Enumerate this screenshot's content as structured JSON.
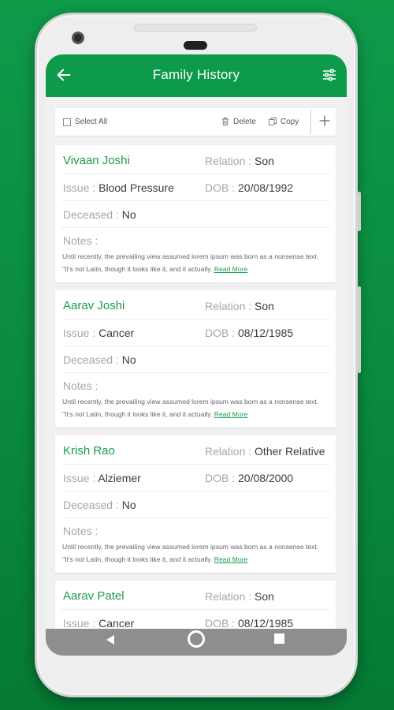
{
  "appbar": {
    "title": "Family History",
    "back_icon": "arrow-left-icon",
    "filter_icon": "sliders-icon"
  },
  "toolbar": {
    "select_all": "Select All",
    "delete": "Delete",
    "copy": "Copy",
    "add_icon": "plus-icon"
  },
  "labels": {
    "relation": "Relation : ",
    "issue": "Issue : ",
    "dob": "DOB : ",
    "deceased": "Deceased : ",
    "notes": "Notes :",
    "read_more": "Read More"
  },
  "records": [
    {
      "name": "Vivaan Joshi",
      "relation": "Son",
      "issue": "Blood Pressure",
      "dob": "20/08/1992",
      "deceased": "No",
      "notes": "Until recently, the prevailing view assumed lorem ipsum was born as a nonsense text. \"It's not Latin, though it looks like it, and it actually."
    },
    {
      "name": "Aarav Joshi",
      "relation": "Son",
      "issue": "Cancer",
      "dob": "08/12/1985",
      "deceased": "No",
      "notes": "Until recently, the prevailing view assumed lorem ipsum was born as a nonsense text. \"It's not Latin, though it looks like it, and it actually."
    },
    {
      "name": "Krish Rao",
      "relation": "Other Relative",
      "issue": "Alziemer",
      "dob": "20/08/2000",
      "deceased": "No",
      "notes": "Until recently, the prevailing view assumed lorem ipsum was born as a nonsense text. \"It's not Latin, though it looks like it, and it actually."
    },
    {
      "name": "Aarav Patel",
      "relation": "Son",
      "issue": "Cancer",
      "dob": "08/12/1985"
    }
  ],
  "colors": {
    "brand": "#0d9a4b",
    "name_green": "#1a9a4a",
    "label_gray": "#a6a6a6"
  }
}
